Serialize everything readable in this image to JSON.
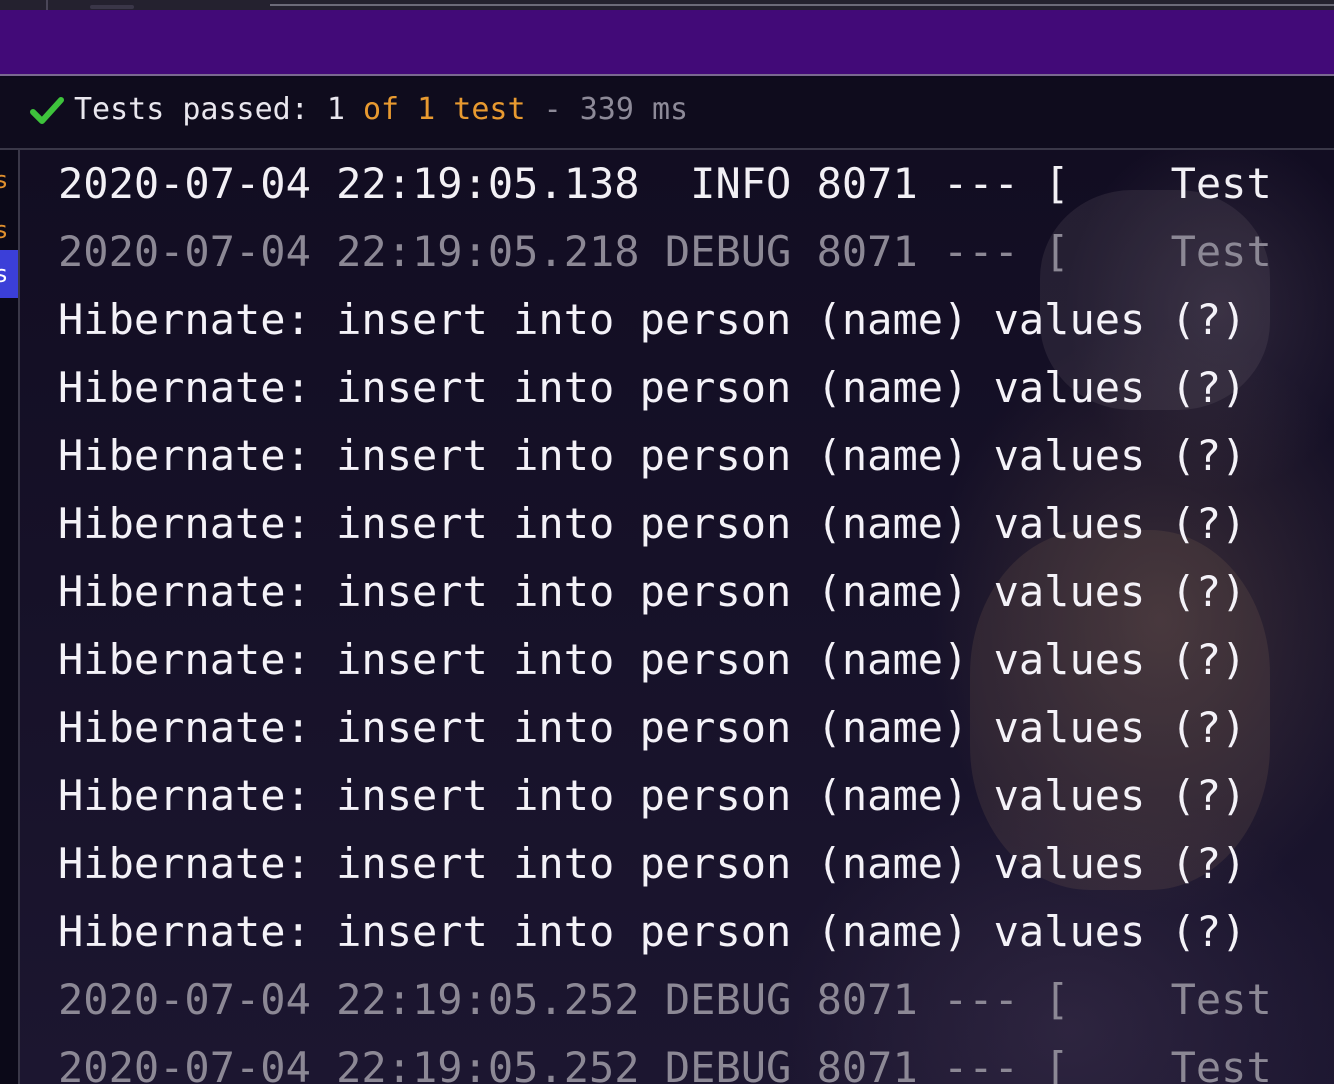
{
  "status": {
    "passed_label": "Tests passed: 1 ",
    "of_label": "of 1 test",
    "separator": " - ",
    "duration": "339 ms"
  },
  "colors": {
    "accent_purple": "#420a78",
    "pass_green": "#3ec33c",
    "count_orange": "#e89a30",
    "selection_blue": "#3b3fd8"
  },
  "gutter": [
    {
      "label": "s",
      "state": "orange"
    },
    {
      "label": "s",
      "state": "orange"
    },
    {
      "label": "s",
      "state": "selected"
    }
  ],
  "console": [
    {
      "level": "info",
      "text": "2020-07-04 22:19:05.138  INFO 8071 --- [    Test"
    },
    {
      "level": "debug",
      "text": "2020-07-04 22:19:05.218 DEBUG 8071 --- [    Test"
    },
    {
      "level": "sql",
      "text": "Hibernate: insert into person (name) values (?)"
    },
    {
      "level": "sql",
      "text": "Hibernate: insert into person (name) values (?)"
    },
    {
      "level": "sql",
      "text": "Hibernate: insert into person (name) values (?)"
    },
    {
      "level": "sql",
      "text": "Hibernate: insert into person (name) values (?)"
    },
    {
      "level": "sql",
      "text": "Hibernate: insert into person (name) values (?)"
    },
    {
      "level": "sql",
      "text": "Hibernate: insert into person (name) values (?)"
    },
    {
      "level": "sql",
      "text": "Hibernate: insert into person (name) values (?)"
    },
    {
      "level": "sql",
      "text": "Hibernate: insert into person (name) values (?)"
    },
    {
      "level": "sql",
      "text": "Hibernate: insert into person (name) values (?)"
    },
    {
      "level": "sql",
      "text": "Hibernate: insert into person (name) values (?)"
    },
    {
      "level": "debug",
      "text": "2020-07-04 22:19:05.252 DEBUG 8071 --- [    Test"
    },
    {
      "level": "debug",
      "text": "2020-07-04 22:19:05.252 DEBUG 8071 --- [    Test"
    }
  ]
}
